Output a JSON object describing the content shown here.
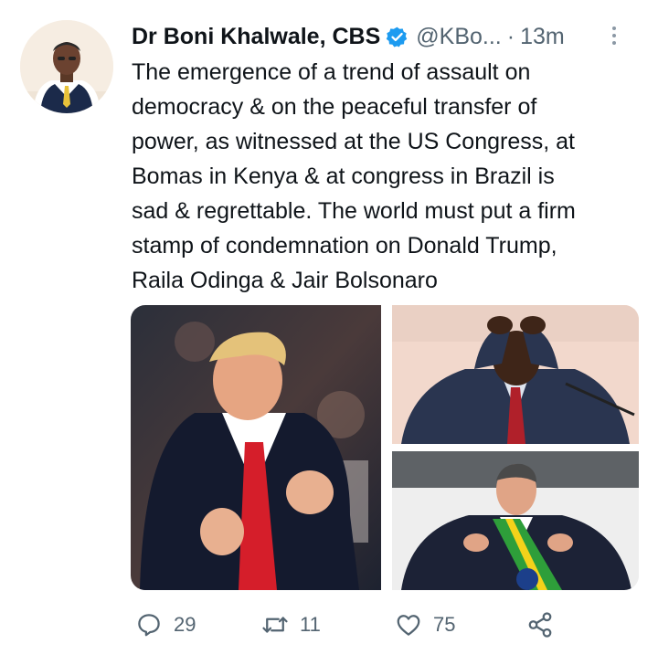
{
  "author": {
    "name": "Dr Boni Khalwale, CBS",
    "handle": "@KBo...",
    "separator": "·",
    "time": "13m",
    "verified_color": "#1d9bf0"
  },
  "tweet": {
    "text": "The emergence of a trend of assault on\ndemocracy & on the peaceful transfer of\npower, as witnessed at the US Congress, at\nBomas in Kenya & at congress in Brazil is\nsad & regrettable. The world must put a firm\nstamp of condemnation on Donald Trump,\nRaila Odinga & Jair Bolsonaro"
  },
  "actions": {
    "reply_count": "29",
    "retweet_count": "11",
    "like_count": "75"
  },
  "icons": {
    "avatar": "avatar",
    "verified": "verified-badge-icon",
    "more": "more-options-icon",
    "reply": "reply-icon",
    "retweet": "retweet-icon",
    "like": "heart-icon",
    "share": "share-icon"
  },
  "colors": {
    "text": "#0f1419",
    "secondary": "#536471"
  }
}
